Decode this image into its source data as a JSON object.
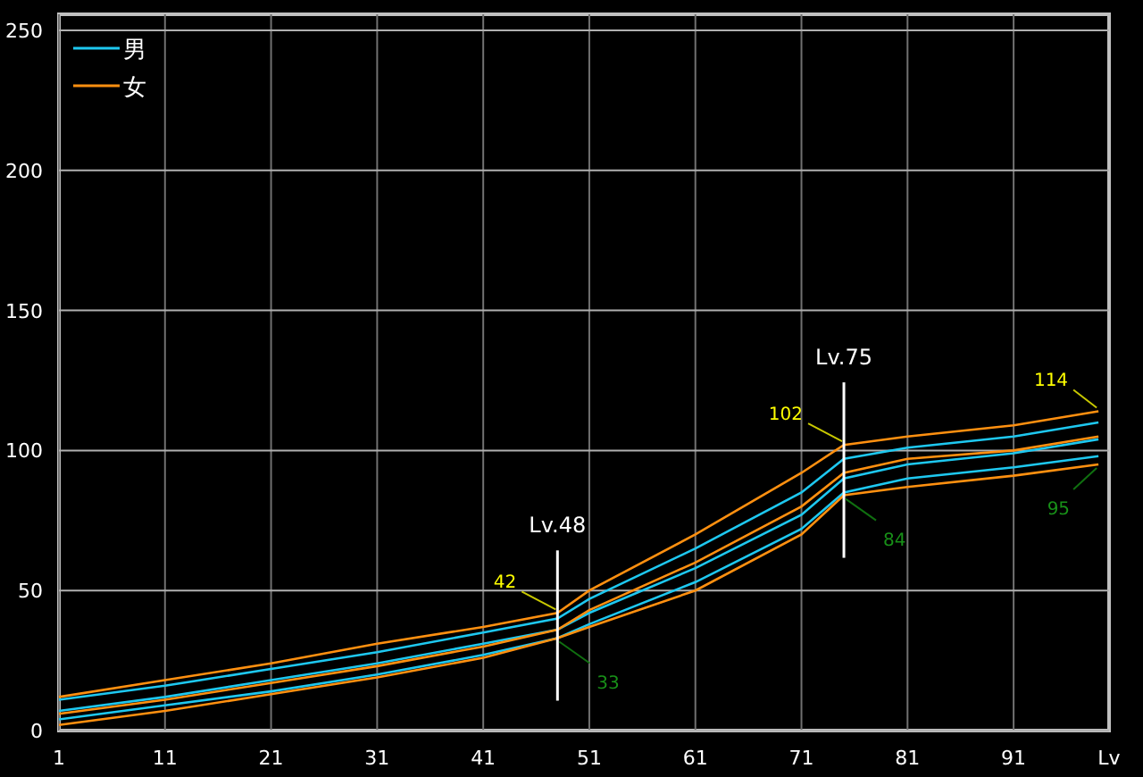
{
  "chart_data": {
    "type": "line",
    "xlabel": "Lv",
    "x": [
      1,
      11,
      21,
      31,
      41,
      48,
      51,
      61,
      71,
      75,
      81,
      91,
      99
    ],
    "xlim": [
      1,
      100
    ],
    "ylim": [
      0,
      250
    ],
    "grid": true,
    "xticks": [
      1,
      11,
      21,
      31,
      41,
      51,
      61,
      71,
      81,
      91
    ],
    "yticks": [
      0,
      50,
      100,
      150,
      200,
      250
    ],
    "series": [
      {
        "name": "男",
        "color": "#1ec8f0",
        "values": [
          7,
          12,
          18,
          24,
          31,
          36,
          42,
          58,
          77,
          90,
          95,
          99,
          104
        ]
      },
      {
        "name": "女",
        "color": "#ff9010",
        "values": [
          6,
          11,
          17,
          23,
          30,
          36,
          43,
          60,
          80,
          92,
          97,
          100,
          105
        ]
      },
      {
        "color": "#1ec8f0",
        "values": [
          11,
          16,
          22,
          28,
          35,
          40,
          47,
          65,
          85,
          97,
          101,
          105,
          110
        ]
      },
      {
        "color": "#1ec8f0",
        "values": [
          4,
          9,
          14,
          20,
          27,
          33,
          38,
          53,
          72,
          85,
          90,
          94,
          98
        ]
      },
      {
        "color": "#ff9010",
        "values": [
          12,
          18,
          24,
          31,
          37,
          42,
          50,
          70,
          92,
          102,
          105,
          109,
          114
        ]
      },
      {
        "color": "#ff9010",
        "values": [
          2,
          7,
          13,
          19,
          26,
          33,
          37,
          50,
          70,
          84,
          87,
          91,
          95
        ]
      }
    ],
    "legend": true,
    "ref_lines": [
      {
        "axis": "x",
        "value": 48,
        "label": "Lv.48"
      },
      {
        "axis": "x",
        "value": 75,
        "label": "Lv.75"
      }
    ],
    "annotations": [
      {
        "x": 48,
        "y": 42,
        "text": "42"
      },
      {
        "x": 48,
        "y": 33,
        "text": "33"
      },
      {
        "x": 75,
        "y": 102,
        "text": "102"
      },
      {
        "x": 75,
        "y": 84,
        "text": "84"
      },
      {
        "x": 99,
        "y": 114,
        "text": "114"
      },
      {
        "x": 99,
        "y": 95,
        "text": "95"
      }
    ]
  }
}
